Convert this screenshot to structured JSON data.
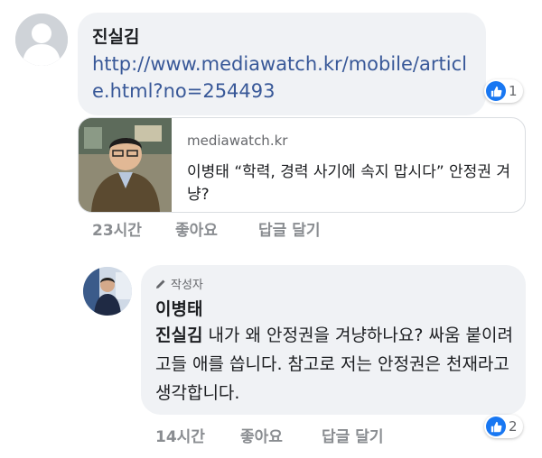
{
  "comment": {
    "author": "진실김",
    "link_text": "http://www.mediawatch.kr/mobile/article.html?no=254493",
    "like_count": "1",
    "preview": {
      "domain": "mediawatch.kr",
      "title": "이병태 “학력, 경력 사기에 속지 맙시다” 안정권 겨냥?"
    },
    "actions": {
      "time": "23시간",
      "like": "좋아요",
      "reply": "답글 달기"
    }
  },
  "reply": {
    "badge": "작성자",
    "author": "이병태",
    "mention": "진실김",
    "text": " 내가 왜 안정권을 겨냥하나요? 싸움 붙이려고들 애를 씁니다. 참고로 저는 안정권은 천재라고 생각합니다.",
    "like_count": "2",
    "actions": {
      "time": "14시간",
      "like": "좋아요",
      "reply": "답글 달기"
    }
  },
  "colors": {
    "bubble": "#f0f2f5",
    "link": "#385898",
    "like_blue": "#1877f2",
    "meta_gray": "#8a8d91"
  },
  "icons": [
    "default-avatar-icon",
    "thumbs-up-icon",
    "pencil-icon"
  ]
}
